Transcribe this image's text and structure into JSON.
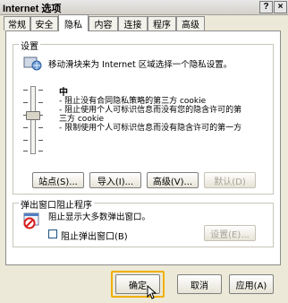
{
  "window": {
    "title": "Internet 选项",
    "help_label": "?",
    "close_label": "×"
  },
  "tabs": [
    {
      "label": "常规"
    },
    {
      "label": "安全"
    },
    {
      "label": "隐私"
    },
    {
      "label": "内容"
    },
    {
      "label": "连接"
    },
    {
      "label": "程序"
    },
    {
      "label": "高级"
    }
  ],
  "settings": {
    "group_label": "设置",
    "instruction": "移动滑块来为 Internet 区域选择一个隐私设置。",
    "level_title": "中",
    "description_lines": [
      "- 阻止没有合同隐私策略的第三方 cookie",
      "- 阻止使用个人可标识信息而没有您的隐含许可的第",
      "三方 cookie",
      "- 限制使用个人可标识信息而没有隐含许可的第一方"
    ],
    "buttons": {
      "sites": "站点(S)...",
      "import": "导入(I)...",
      "advanced": "高级(V)...",
      "default": "默认(D)"
    }
  },
  "popup": {
    "group_label": "弹出窗口阻止程序",
    "description": "阻止显示大多数弹出窗口。",
    "checkbox_label": "阻止弹出窗口(B)",
    "checkbox_checked": false,
    "settings_button": "设置(E)..."
  },
  "footer": {
    "ok": "确定",
    "cancel": "取消",
    "apply": "应用(A)"
  }
}
